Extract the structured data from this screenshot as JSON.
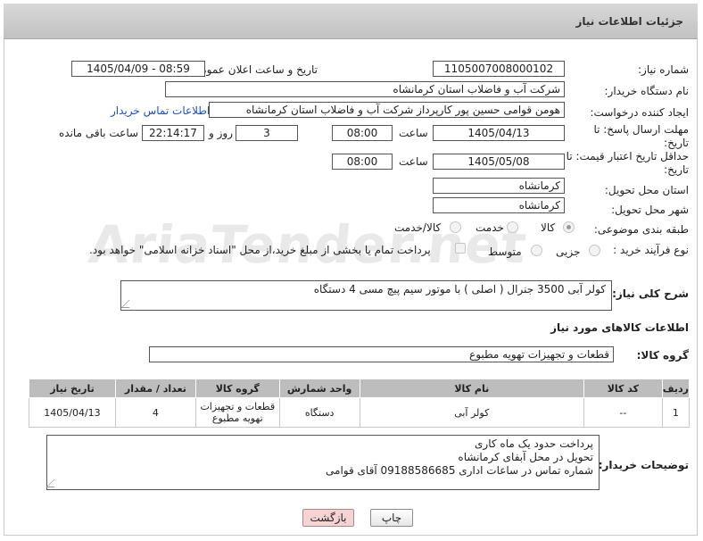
{
  "header": {
    "title": "جزئیات اطلاعات نیاز"
  },
  "watermark": "AriaTender.net",
  "fields": {
    "need_number_label": "شماره نیاز:",
    "need_number": "1105007008000102",
    "announce_label": "تاریخ و ساعت اعلان عمومی:",
    "announce_value": "1405/04/09 - 08:59",
    "buyer_org_label": "نام دستگاه خریدار:",
    "buyer_org": "شرکت آب و فاضلاب استان کرمانشاه",
    "creator_label": "ایجاد کننده درخواست:",
    "creator": "هومن قوامی حسین پور کارپرداز شرکت آب و فاضلاب استان کرمانشاه",
    "contact_link": "اطلاعات تماس خریدار",
    "deadline_label": "مهلت ارسال پاسخ: تا تاریخ:",
    "deadline_date": "1405/04/13",
    "time_label": "ساعت",
    "deadline_time": "08:00",
    "days_value": "3",
    "days_label": "روز و",
    "remaining_time": "22:14:17",
    "remaining_label": "ساعت باقی مانده",
    "price_validity_label": "حداقل تاریخ اعتبار قیمت: تا تاریخ:",
    "price_validity_date": "1405/05/08",
    "price_validity_time": "08:00",
    "province_label": "استان محل تحویل:",
    "province": "کرمانشاه",
    "city_label": "شهر محل تحویل:",
    "city": "کرمانشاه",
    "category_label": "طبقه بندی موضوعی:",
    "category_options": [
      "کالا",
      "خدمت",
      "کالا/خدمت"
    ],
    "process_label": "نوع فرآیند خرید :",
    "process_options": [
      "جزیی",
      "متوسط"
    ],
    "payment_note": "پرداخت تمام یا بخشی از مبلغ خرید،از محل \"اسناد خزانه اسلامی\" خواهد بود."
  },
  "description": {
    "label": "شرح کلی نیاز:",
    "text": "کولر آبی 3500 جنرال ( اصلی ) با موتور سیم پیچ مسی  4 دستگاه"
  },
  "goods": {
    "section_title": "اطلاعات کالاهای مورد نیاز",
    "group_label": "گروه کالا:",
    "group_value": "قطعات و تجهیزات تهویه مطبوع"
  },
  "table": {
    "headers": [
      "ردیف",
      "کد کالا",
      "نام کالا",
      "واحد شمارش",
      "گروه کالا",
      "تعداد / مقدار",
      "تاریخ نیاز"
    ],
    "rows": [
      [
        "1",
        "--",
        "کولر آبی",
        "دستگاه",
        "قطعات و تجهیزات تهویه مطبوع",
        "4",
        "1405/04/13"
      ]
    ]
  },
  "buyer_notes": {
    "label": "توضیحات خریدار:",
    "lines": [
      "پرداخت حدود یک ماه کاری",
      "تحویل در محل آبفای کرمانشاه",
      "شماره تماس در ساعات اداری 09188586685 آقای قوامی"
    ]
  },
  "buttons": {
    "print": "چاپ",
    "back": "بازگشت"
  },
  "colors": {
    "back_button_bg": "#f6d3d3",
    "header_bg": "#c8c8c8",
    "table_header_bg": "#bdbdbd",
    "link": "#1f4fb8"
  }
}
